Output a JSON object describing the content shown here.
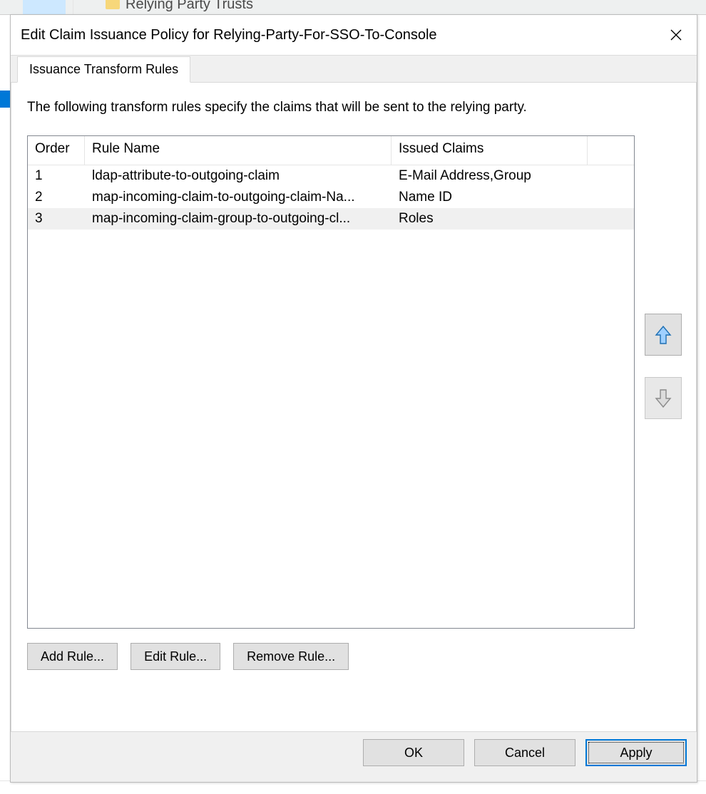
{
  "background": {
    "tree_item": "Relying Party Trusts"
  },
  "dialog": {
    "title": "Edit Claim Issuance Policy for Relying-Party-For-SSO-To-Console",
    "tabs": {
      "issuance_transform_rules": "Issuance Transform Rules"
    },
    "description": "The following transform rules specify the claims that will be sent to the relying party.",
    "columns": {
      "order": "Order",
      "rule_name": "Rule Name",
      "issued_claims": "Issued Claims"
    },
    "rows": [
      {
        "order": "1",
        "rule_name": "ldap-attribute-to-outgoing-claim",
        "issued_claims": "E-Mail Address,Group",
        "selected": false
      },
      {
        "order": "2",
        "rule_name": "map-incoming-claim-to-outgoing-claim-Na...",
        "issued_claims": "Name ID",
        "selected": false
      },
      {
        "order": "3",
        "rule_name": "map-incoming-claim-group-to-outgoing-cl...",
        "issued_claims": "Roles",
        "selected": true
      }
    ],
    "buttons": {
      "add_rule": "Add Rule...",
      "edit_rule": "Edit Rule...",
      "remove_rule": "Remove Rule...",
      "ok": "OK",
      "cancel": "Cancel",
      "apply": "Apply"
    },
    "move": {
      "up_enabled": true,
      "down_enabled": false
    }
  }
}
